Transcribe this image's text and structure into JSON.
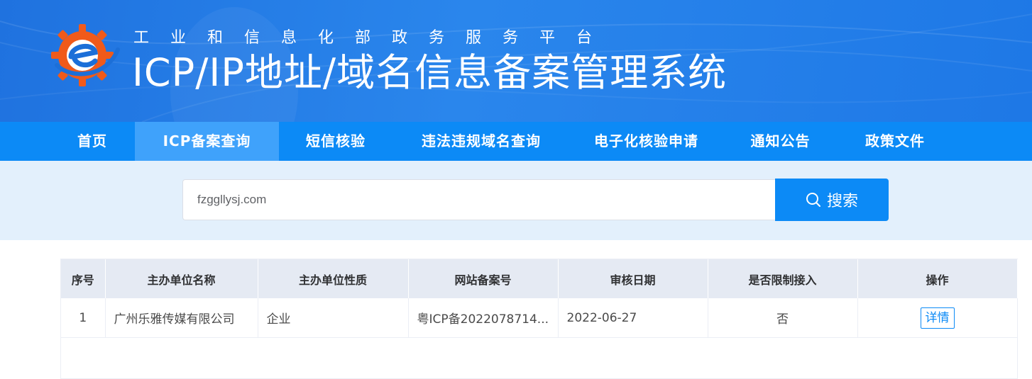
{
  "header": {
    "subtitle": "工业和信息化部政务服务平台",
    "title": "ICP/IP地址/域名信息备案管理系统"
  },
  "nav": {
    "items": [
      {
        "label": "首页",
        "active": false
      },
      {
        "label": "ICP备案查询",
        "active": true
      },
      {
        "label": "短信核验",
        "active": false
      },
      {
        "label": "违法违规域名查询",
        "active": false
      },
      {
        "label": "电子化核验申请",
        "active": false
      },
      {
        "label": "通知公告",
        "active": false
      },
      {
        "label": "政策文件",
        "active": false
      }
    ]
  },
  "search": {
    "value": "fzggllysj.com",
    "button_label": "搜索"
  },
  "table": {
    "headers": [
      "序号",
      "主办单位名称",
      "主办单位性质",
      "网站备案号",
      "审核日期",
      "是否限制接入",
      "操作"
    ],
    "rows": [
      {
        "index": "1",
        "org_name": "广州乐雅传媒有限公司",
        "org_type": "企业",
        "record_no": "粤ICP备2022078714...",
        "review_date": "2022-06-27",
        "restricted": "否",
        "action": "详情"
      }
    ]
  },
  "colors": {
    "header_blue": "#1f72df",
    "nav_blue": "#0c8af6",
    "nav_active": "#3fa2fb",
    "search_bg": "#e3f0fc",
    "table_header_bg": "#e5eaf3",
    "logo_orange": "#f05a1a"
  }
}
